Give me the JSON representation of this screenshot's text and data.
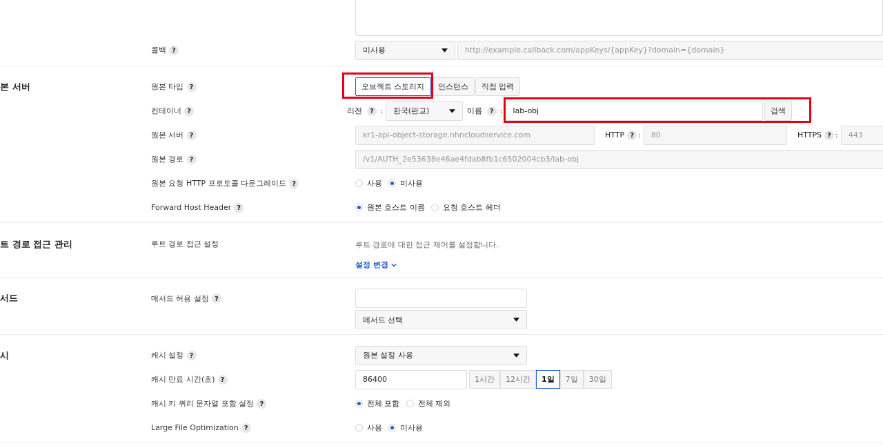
{
  "sections": [
    {
      "rows": [
        {
          "kind": "textarea"
        },
        {
          "kind": "select_input",
          "label": "콜백",
          "help": "?",
          "select": {
            "value": "미사용"
          },
          "input": {
            "value": "http://example.callback.com/appKeys/{appKey}?domain={domain}",
            "disabled": true
          }
        }
      ]
    },
    {
      "title": "본 서버",
      "rows": [
        {
          "kind": "segmented",
          "label": "원본 타입",
          "help": "?",
          "options": [
            {
              "label": "오브젝트 스토리지",
              "selected": true,
              "highlighted": true
            },
            {
              "label": "인스턴스",
              "selected": false,
              "highlighted": false
            },
            {
              "label": "직접 입력",
              "selected": false,
              "highlighted": false
            }
          ]
        },
        {
          "kind": "container",
          "label": "컨테이너",
          "help": "?",
          "region": {
            "label": "리전",
            "help": "?",
            "separator": ":",
            "value": "한국(판교)"
          },
          "name": {
            "label": "이름",
            "help": "?",
            "separator": ":",
            "value": "lab-obj",
            "highlighted": true
          },
          "button": {
            "label": "검색"
          }
        },
        {
          "kind": "server",
          "label": "원본 서버",
          "help": "?",
          "input": {
            "value": "kr1-api-object-storage.nhncloudservice.com",
            "disabled": true
          },
          "ports": [
            {
              "label": "HTTP",
              "help": "?",
              "separator": ":",
              "value": "80",
              "disabled": true
            },
            {
              "label": "HTTPS",
              "help": "?",
              "separator": ":",
              "value": "443",
              "disabled": true
            }
          ]
        },
        {
          "kind": "input",
          "label": "원본 경로",
          "help": "?",
          "value": "/v1/AUTH_2e53638e46ae4fdab8fb1c6502004cb3/lab-obj",
          "disabled": true
        },
        {
          "kind": "radio",
          "label": "원본 요청 HTTP 프로토콜 다운그레이드",
          "help": "?",
          "options": [
            {
              "label": "사용",
              "selected": false
            },
            {
              "label": "미사용",
              "selected": true
            }
          ]
        },
        {
          "kind": "radio",
          "label": "Forward Host Header",
          "help": "?",
          "options": [
            {
              "label": "원본 호스트 이름",
              "selected": true
            },
            {
              "label": "요청 호스트 헤더",
              "selected": false
            }
          ]
        }
      ]
    },
    {
      "title": "트 경로 접근 관리",
      "rows": [
        {
          "kind": "description",
          "label": "루트 경로 접근 설정",
          "text": "루트 경로에 대한 접근 제어를 설정합니다.",
          "link": "설정 변경"
        }
      ]
    },
    {
      "title": "서드",
      "rows": [
        {
          "kind": "method",
          "label": "메서드 허용 설정",
          "help": "?",
          "select": {
            "value": "메서드 선택"
          }
        }
      ]
    },
    {
      "title": "시",
      "rows": [
        {
          "kind": "select",
          "label": "캐시 설정",
          "help": "?",
          "value": "원본 설정 사용"
        },
        {
          "kind": "presets",
          "label": "캐시 만료 시간(초)",
          "help": "?",
          "value": "86400",
          "options": [
            {
              "label": "1시간",
              "selected": false
            },
            {
              "label": "12시간",
              "selected": false
            },
            {
              "label": "1일",
              "selected": true
            },
            {
              "label": "7일",
              "selected": false
            },
            {
              "label": "30일",
              "selected": false
            }
          ]
        },
        {
          "kind": "radio",
          "label": "캐시 키 쿼리 문자열 포함 설정",
          "help": "?",
          "options": [
            {
              "label": "전체 포함",
              "selected": true
            },
            {
              "label": "전체 제외",
              "selected": false
            }
          ]
        },
        {
          "kind": "radio",
          "label": "Large File Optimization",
          "help": "?",
          "options": [
            {
              "label": "사용",
              "selected": false
            },
            {
              "label": "미사용",
              "selected": true
            }
          ]
        }
      ]
    }
  ]
}
